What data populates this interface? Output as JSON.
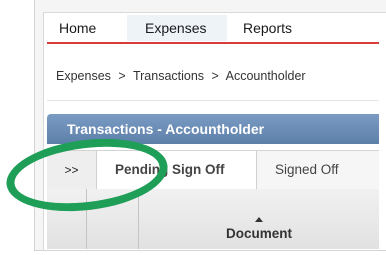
{
  "nav": {
    "tabs": [
      {
        "label": "Home",
        "active": false
      },
      {
        "label": "Expenses",
        "active": true
      },
      {
        "label": "Reports",
        "active": false
      }
    ]
  },
  "breadcrumb": {
    "items": [
      "Expenses",
      "Transactions",
      "Accountholder"
    ],
    "separator": ">"
  },
  "section": {
    "title": "Transactions - Accountholder"
  },
  "subtabs": {
    "expand_label": ">>",
    "pending_label": "Pending Sign Off",
    "signed_label": "Signed Off"
  },
  "table": {
    "columns": [
      {
        "label": ""
      },
      {
        "label": ""
      },
      {
        "label": "Document",
        "sorted": "ascending"
      }
    ]
  },
  "colors": {
    "accent_red": "#d93a3a",
    "header_blue": "#6a8cb6",
    "highlight_green": "#1e9e57"
  }
}
